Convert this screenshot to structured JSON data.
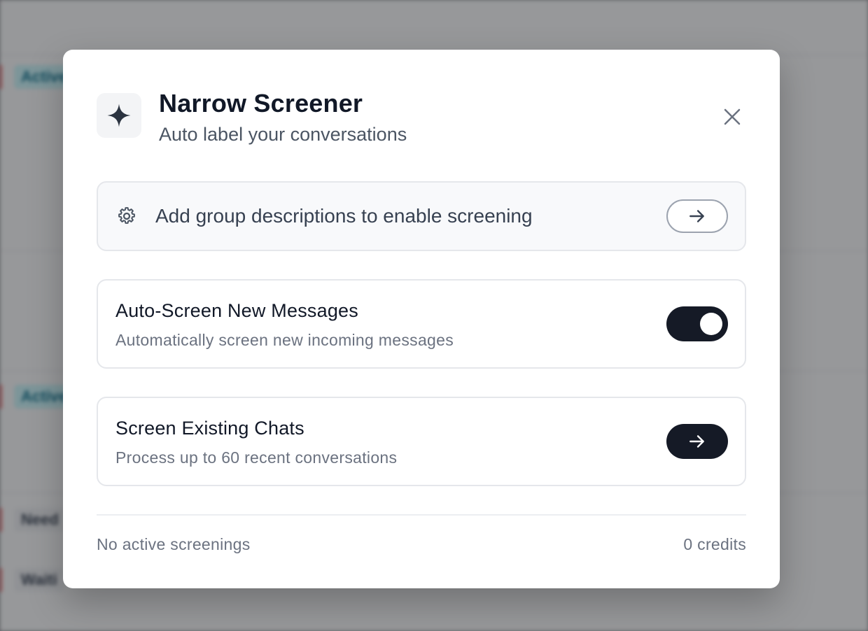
{
  "background": {
    "pills": [
      "Active",
      "Active"
    ],
    "rows": [
      "Need",
      "Waiti"
    ]
  },
  "modal": {
    "title": "Narrow Screener",
    "subtitle": "Auto label your conversations",
    "logo_icon": "sparkle-icon",
    "close_icon": "close-icon"
  },
  "notice": {
    "icon": "gear-icon",
    "text": "Add group descriptions to enable screening",
    "button_icon": "arrow-right-icon"
  },
  "auto_screen": {
    "title": "Auto-Screen New Messages",
    "description": "Automatically screen new incoming messages",
    "enabled": true
  },
  "existing_chats": {
    "title": "Screen Existing Chats",
    "description": "Process up to 60 recent conversations",
    "button_icon": "arrow-right-icon"
  },
  "footer": {
    "status": "No active screenings",
    "credits": "0 credits"
  },
  "colors": {
    "primary_dark": "#151a26",
    "text_muted": "#6b7280",
    "border": "#e5e7eb"
  }
}
